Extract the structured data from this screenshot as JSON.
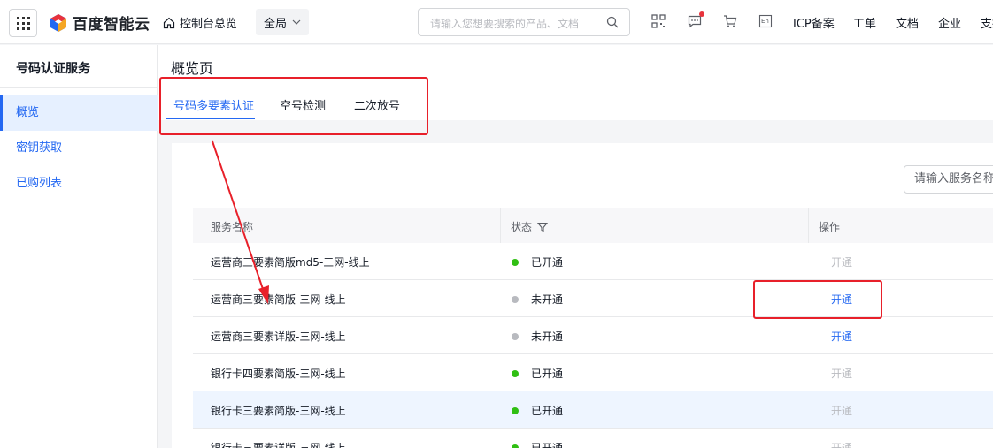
{
  "header": {
    "logo_text": "百度智能云",
    "nav_home": "控制台总览",
    "region": "全局",
    "search_placeholder": "请输入您想要搜索的产品、文档",
    "links": [
      "ICP备案",
      "工单",
      "文档",
      "企业",
      "支持"
    ],
    "icons": [
      "qrcode-icon",
      "message-icon",
      "cart-icon",
      "language-en-icon"
    ],
    "lang_label": "En"
  },
  "sidebar": {
    "title": "号码认证服务",
    "items": [
      {
        "label": "概览",
        "active": true
      },
      {
        "label": "密钥获取",
        "active": false
      },
      {
        "label": "已购列表",
        "active": false
      }
    ]
  },
  "main": {
    "page_title": "概览页",
    "tabs": [
      {
        "label": "号码多要素认证",
        "active": true
      },
      {
        "label": "空号检测",
        "active": false
      },
      {
        "label": "二次放号",
        "active": false
      }
    ],
    "service_search_placeholder": "请输入服务名称"
  },
  "table": {
    "columns": [
      "服务名称",
      "状态",
      "操作"
    ],
    "rows": [
      {
        "name": "运营商三要素简版md5-三网-线上",
        "status": "已开通",
        "status_color": "#30bf13",
        "action": "开通",
        "action_enabled": false
      },
      {
        "name": "运营商三要素简版-三网-线上",
        "status": "未开通",
        "status_color": "#b8babf",
        "action": "开通",
        "action_enabled": true
      },
      {
        "name": "运营商三要素详版-三网-线上",
        "status": "未开通",
        "status_color": "#b8babf",
        "action": "开通",
        "action_enabled": true
      },
      {
        "name": "银行卡四要素简版-三网-线上",
        "status": "已开通",
        "status_color": "#30bf13",
        "action": "开通",
        "action_enabled": false
      },
      {
        "name": "银行卡三要素简版-三网-线上",
        "status": "已开通",
        "status_color": "#30bf13",
        "action": "开通",
        "action_enabled": false,
        "highlighted": true
      },
      {
        "name": "银行卡三要素详版-三网-线上",
        "status": "已开通",
        "status_color": "#30bf13",
        "action": "开通",
        "action_enabled": false
      }
    ]
  },
  "colors": {
    "accent": "#2468f2",
    "annotation": "#e8202a",
    "active_status": "#30bf13",
    "inactive_status": "#b8babf"
  }
}
